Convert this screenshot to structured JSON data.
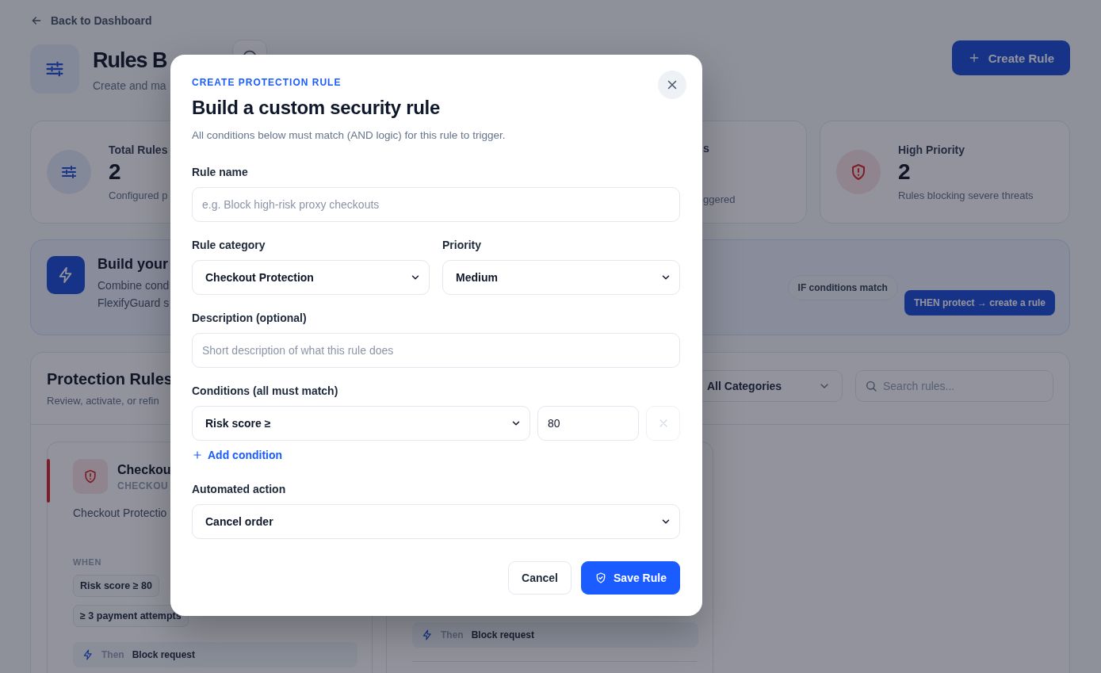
{
  "page": {
    "back_link": "Back to Dashboard",
    "title": "Rules B",
    "subtitle": "Create and ma",
    "create_button": "Create Rule"
  },
  "stats": [
    {
      "kind": "rules",
      "label": "Total Rules",
      "value": "2",
      "caption": "Configured p"
    },
    {
      "kind": "hidden"
    },
    {
      "kind": "fragment",
      "label": "s",
      "caption": "ggered"
    },
    {
      "kind": "priority",
      "label": "High Priority",
      "value": "2",
      "caption": "Rules blocking severe threats"
    }
  ],
  "banner": {
    "title": "Build your",
    "lines": [
      "Combine cond",
      "FlexifyGuard s"
    ],
    "pills": [
      {
        "label": "IF conditions match",
        "kind": "if"
      },
      {
        "label": "THEN protect → create a rule",
        "kind": "then"
      }
    ]
  },
  "rules_panel": {
    "title": "Protection Rules",
    "subtitle": "Review, activate, or refin",
    "category_filter": "All Categories",
    "search": {
      "placeholder": "Search rules..."
    },
    "cards": [
      {
        "kind": "flagged",
        "title": "Checkou",
        "category": "CHECKOU",
        "description": "Checkout Protectio",
        "when_label": "WHEN",
        "conditions": [
          "Risk score ≥ 80",
          "≥ 3 payment attempts"
        ],
        "then_label": "Then",
        "action": "Block request"
      },
      {
        "kind": "partial",
        "then_label": "Then",
        "action": "Block request"
      }
    ]
  },
  "modal": {
    "eyebrow": "CREATE PROTECTION RULE",
    "title": "Build a custom security rule",
    "subtitle": "All conditions below must match (AND logic) for this rule to trigger.",
    "rule_name": {
      "label": "Rule name",
      "placeholder": "e.g. Block high-risk proxy checkouts"
    },
    "category": {
      "label": "Rule category",
      "value": "Checkout Protection"
    },
    "priority": {
      "label": "Priority",
      "value": "Medium"
    },
    "description": {
      "label": "Description (optional)",
      "placeholder": "Short description of what this rule does"
    },
    "conditions": {
      "label": "Conditions (all must match)",
      "items": [
        {
          "field": "Risk score ≥",
          "value": "80",
          "disabled": true
        }
      ],
      "add_label": "Add condition"
    },
    "action": {
      "label": "Automated action",
      "value": "Cancel order"
    },
    "buttons": [
      {
        "label": "Cancel",
        "kind": "secondary"
      },
      {
        "label": "Save Rule",
        "kind": "primary"
      }
    ]
  }
}
